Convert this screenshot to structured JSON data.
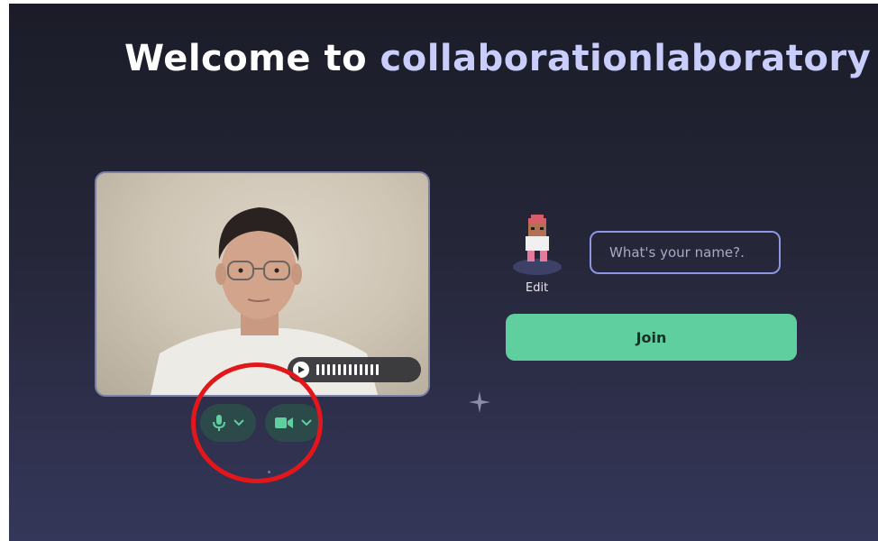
{
  "header": {
    "title_prefix": "Welcome to",
    "space_name": "collaborationlaboratory"
  },
  "preview": {
    "controls": {
      "mic_icon": "microphone-icon",
      "camera_icon": "video-camera-icon",
      "dropdown_icon": "chevron-down-icon"
    },
    "audio_indicator_icon": "play-icon"
  },
  "profile": {
    "edit_label": "Edit",
    "name_placeholder": "What's your name?.",
    "name_value": ""
  },
  "actions": {
    "join_label": "Join"
  },
  "colors": {
    "accent_green": "#5fcfa0",
    "highlight_lavender": "#c8cdfc",
    "annotation_red": "#e3171b"
  }
}
